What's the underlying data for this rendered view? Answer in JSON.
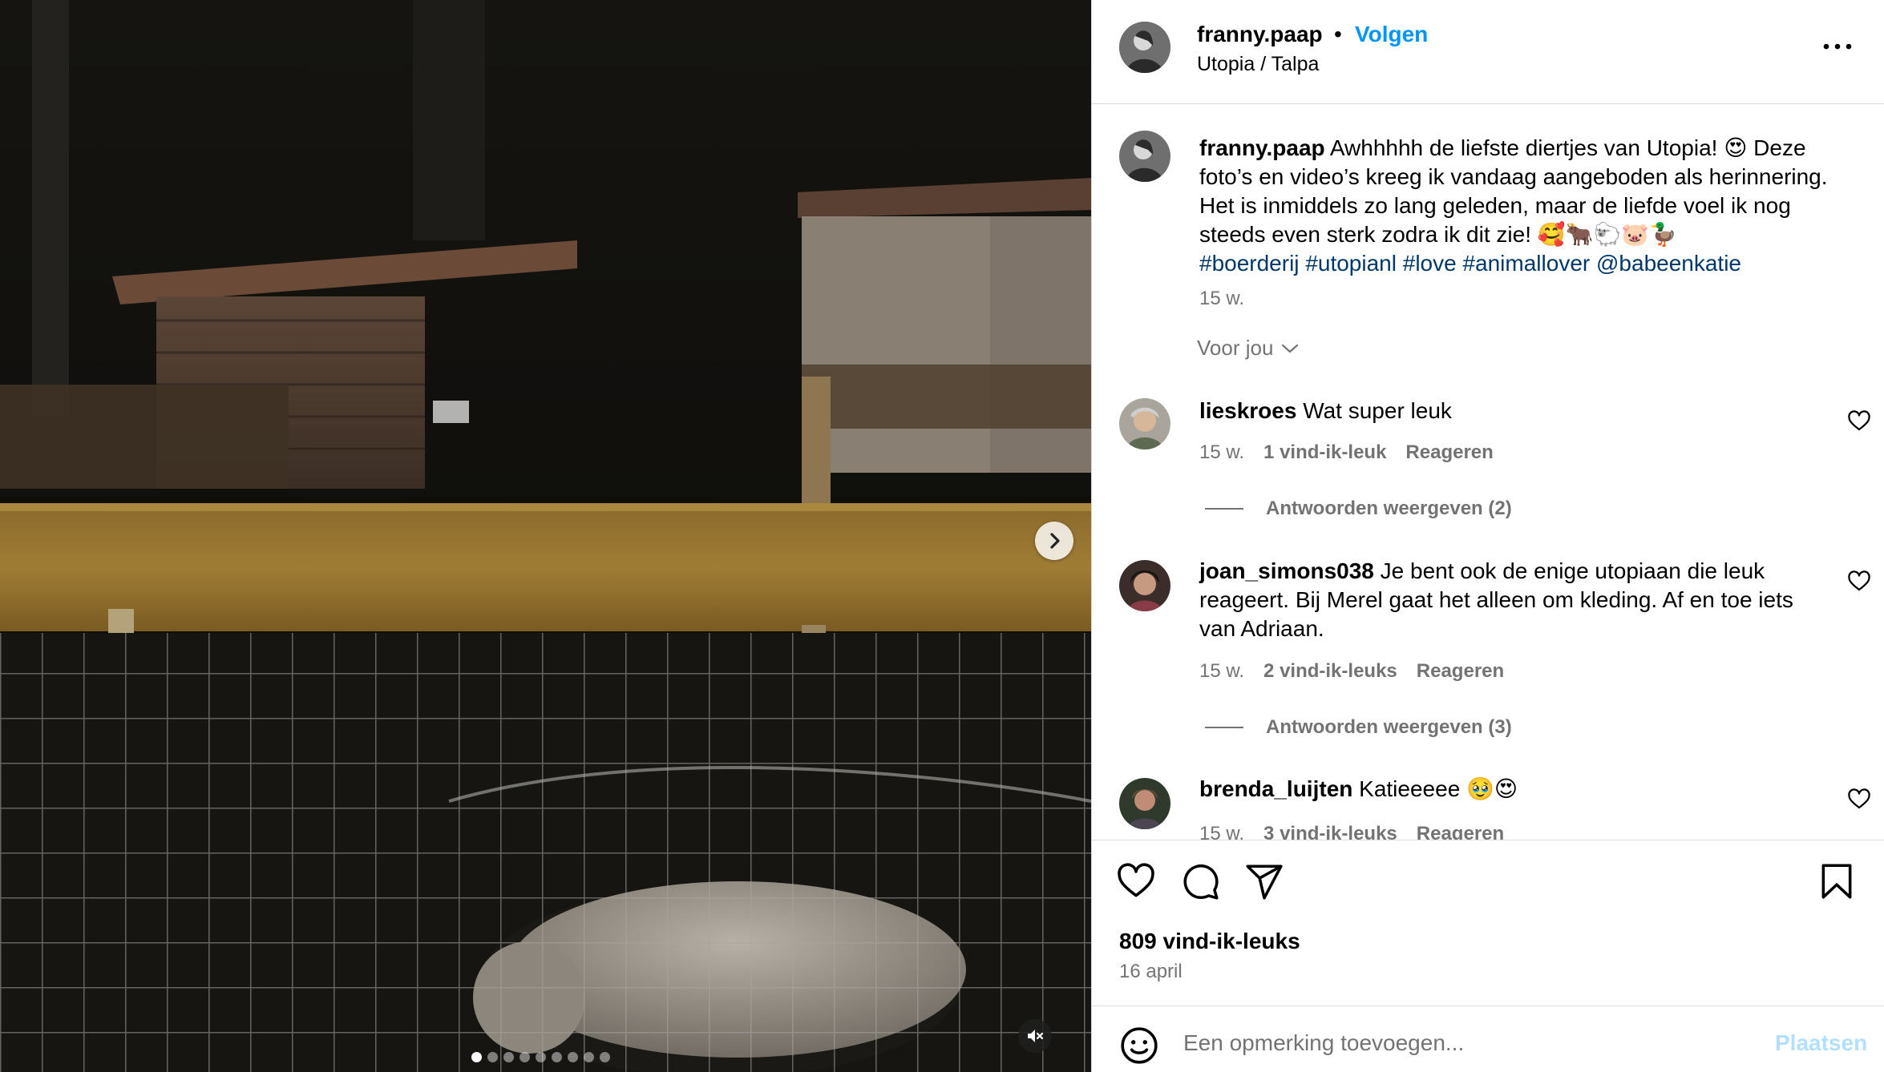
{
  "post": {
    "username": "franny.paap",
    "separator": "•",
    "follow_label": "Volgen",
    "location": "Utopia / Talpa",
    "caption_text": "Awhhhhh de liefste diertjes van Utopia! 😍 Deze foto’s en video’s kreeg ik vandaag aangeboden als herinnering. Het is inmiddels zo lang geleden, maar de liefde voel ik nog steeds even sterk zodra ik dit zie! 🥰🐂🐑🐷🦆",
    "hashtags": [
      "#boerderij",
      "#utopianl",
      "#love",
      "#animallover",
      "@babeenkatie"
    ],
    "caption_time": "15 w.",
    "for_you_label": "Voor jou",
    "like_count_label": "809 vind-ik-leuks",
    "date": "16 april",
    "carousel": {
      "total": 9,
      "active": 1
    },
    "colors": {
      "accent": "#0095f6",
      "tag": "#00376b",
      "muted": "#737373"
    }
  },
  "comments": [
    {
      "username": "lieskroes",
      "text": "Wat super leuk",
      "time": "15 w.",
      "likes": "1 vind-ik-leuk",
      "reply_label": "Reageren",
      "view_replies": "Antwoorden weergeven (2)"
    },
    {
      "username": "joan_simons038",
      "text": "Je bent ook de enige utopiaan die leuk reageert. Bij Merel gaat het alleen om kleding. Af en toe iets van Adriaan.",
      "time": "15 w.",
      "likes": "2 vind-ik-leuks",
      "reply_label": "Reageren",
      "view_replies": "Antwoorden weergeven (3)"
    },
    {
      "username": "brenda_luijten",
      "text": "Katieeeee 🥹😍",
      "time": "15 w.",
      "likes": "3 vind-ik-leuks",
      "reply_label": "Reageren"
    }
  ],
  "composer": {
    "placeholder": "Een opmerking toevoegen...",
    "post_label": "Plaatsen"
  },
  "icons": {
    "more": "more-options-icon",
    "like": "heart-icon",
    "comment": "comment-bubble-icon",
    "share": "paper-plane-icon",
    "save": "bookmark-icon",
    "emoji": "smiley-icon",
    "next": "chevron-right-icon",
    "mute": "speaker-muted-icon"
  }
}
